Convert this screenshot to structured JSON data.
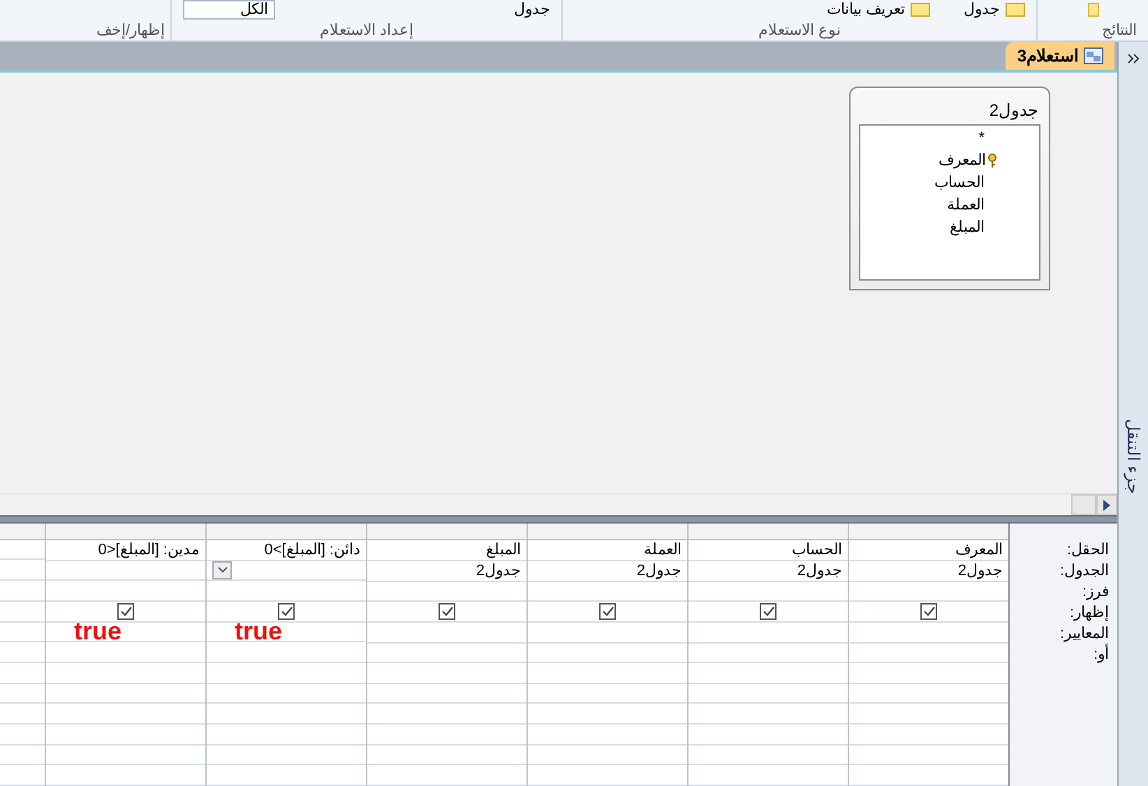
{
  "ribbon": {
    "items": [
      {
        "kind": "button",
        "label": "جدول"
      },
      {
        "kind": "button",
        "label": "تعريف بيانات"
      },
      {
        "kind": "button",
        "label": "جدول"
      },
      {
        "kind": "field",
        "value": "الكل"
      }
    ],
    "groups": [
      "النتائج",
      "نوع الاستعلام",
      "إعداد الاستعلام",
      "إظهار/إخف"
    ]
  },
  "document_tab": {
    "label": "استعلام3",
    "selected": true
  },
  "table_box": {
    "title": "جدول2",
    "fields": [
      {
        "name": "*",
        "key": false
      },
      {
        "name": "المعرف",
        "key": true
      },
      {
        "name": "الحساب",
        "key": false
      },
      {
        "name": "العملة",
        "key": false
      },
      {
        "name": "المبلغ",
        "key": false
      }
    ]
  },
  "grid": {
    "row_labels": [
      "الحقل:",
      "الجدول:",
      "فرز:",
      "إظهار:",
      "المعايير:",
      "أو:"
    ],
    "columns": [
      {
        "field": "المعرف",
        "table": "جدول2",
        "show": true,
        "dropdown": false
      },
      {
        "field": "الحساب",
        "table": "جدول2",
        "show": true,
        "dropdown": false
      },
      {
        "field": "العملة",
        "table": "جدول2",
        "show": true,
        "dropdown": false
      },
      {
        "field": "المبلغ",
        "table": "جدول2",
        "show": true,
        "dropdown": false
      },
      {
        "field": "دائن: [المبلغ]>0",
        "show": true,
        "dropdown": true,
        "note": "true"
      },
      {
        "field": "مدين: [المبلغ]<0",
        "show": true,
        "dropdown": false,
        "note": "true"
      }
    ]
  },
  "navigation_pane": {
    "label": "جزء التنقل",
    "collapsed": true
  }
}
